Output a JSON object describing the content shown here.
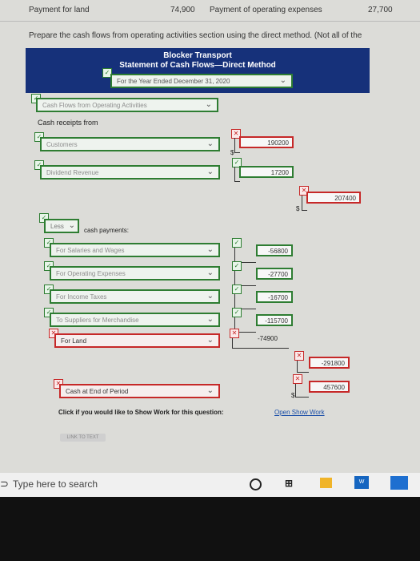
{
  "header": {
    "payment_land_label": "Payment for land",
    "payment_land_value": "74,900",
    "payment_opex_label": "Payment of operating expenses",
    "payment_opex_value": "27,700"
  },
  "instruction": "Prepare the cash flows from operating activities section using the direct method. (Not all of the",
  "statement": {
    "company": "Blocker Transport",
    "title": "Statement of Cash Flows—Direct Method",
    "period": "For the Year Ended December 31, 2020"
  },
  "section": {
    "heading": "Cash Flows from Operating Activities",
    "receipts_label": "Cash receipts from",
    "less_select": "Less",
    "payments_label": "cash payments:"
  },
  "receipts": [
    {
      "label": "Customers",
      "value": "190200"
    },
    {
      "label": "Dividend Revenue",
      "value": "17200"
    }
  ],
  "receipts_total": "207400",
  "payments": [
    {
      "label": "For Salaries and Wages",
      "value": "-56800"
    },
    {
      "label": "For Operating Expenses",
      "value": "-27700"
    },
    {
      "label": "For Income Taxes",
      "value": "-16700"
    },
    {
      "label": "To Suppliers for Merchandise",
      "value": "-115700"
    },
    {
      "label": "For Land",
      "value": "-74900"
    }
  ],
  "payments_total": "-291800",
  "end_row": {
    "label": "Cash at End of Period",
    "value": "457600"
  },
  "dollar_sign": "$",
  "show_work": {
    "prompt": "Click if you would like to Show Work for this question:",
    "link": "Open Show Work"
  },
  "link_to_text": "LINK TO TEXT",
  "taskbar": {
    "search_placeholder": "Type here to search",
    "store_label": "W"
  }
}
